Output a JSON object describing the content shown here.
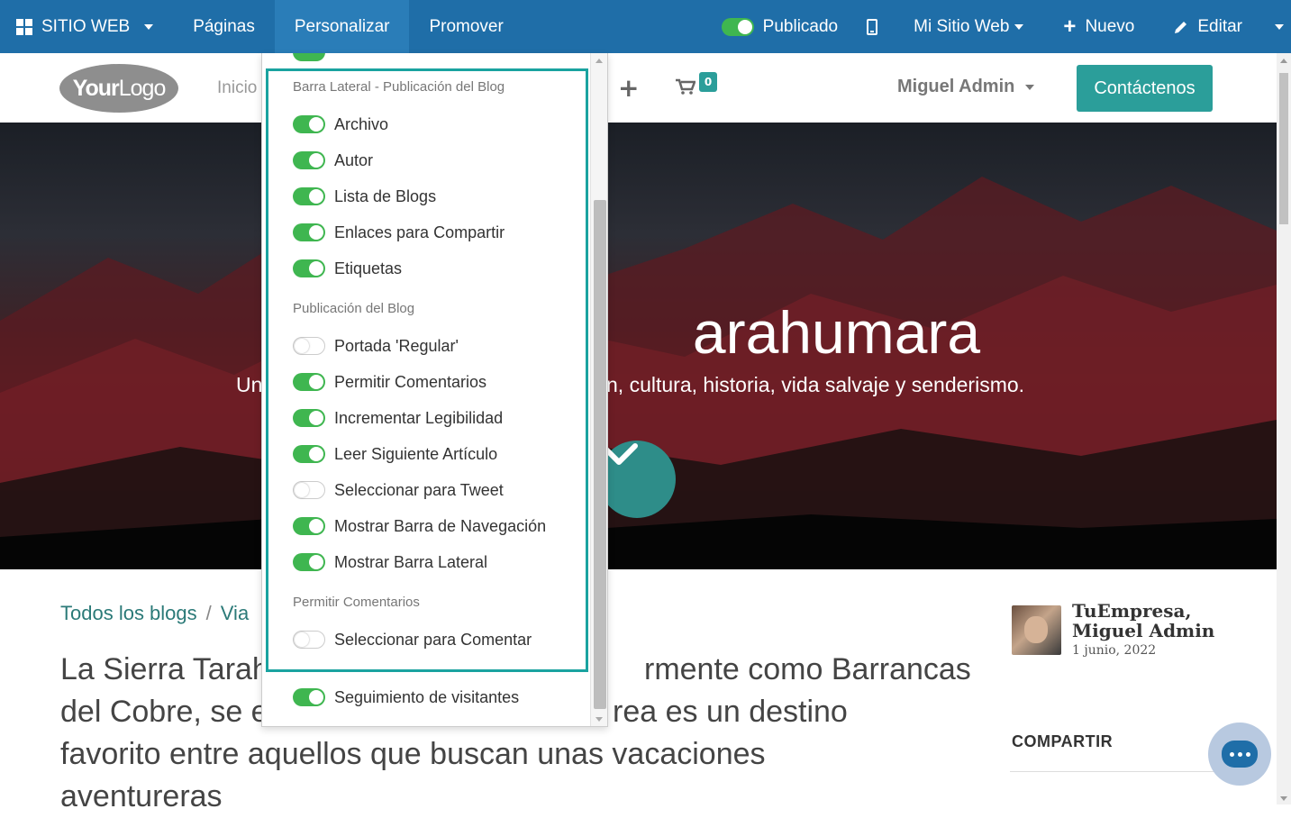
{
  "topbar": {
    "brand": "SITIO WEB",
    "menu": [
      {
        "label": "Páginas"
      },
      {
        "label": "Personalizar"
      },
      {
        "label": "Promover"
      }
    ],
    "published_label": "Publicado",
    "site_selector": "Mi Sitio Web",
    "new_label": "Nuevo",
    "edit_label": "Editar"
  },
  "header": {
    "logo_bold": "Your",
    "logo_light": "Logo",
    "nav_first": "Inicio",
    "cart_count": "0",
    "user_name": "Miguel Admin",
    "contact_label": "Contáctenos"
  },
  "hero": {
    "title_visible": "arahumara",
    "subtitle_left": "Un",
    "subtitle_right": "n, cultura, historia, vida salvaje y senderismo."
  },
  "content": {
    "breadcrumb_all": "Todos los blogs",
    "breadcrumb_sep": "/",
    "breadcrumb_current": "Via",
    "lead_lines": [
      "La Sierra Tarah",
      "rmente como Barrancas",
      "del Cobre, se e",
      "rea es un destino",
      "favorito entre aquellos que buscan unas vacaciones",
      "aventureras"
    ]
  },
  "sidebar": {
    "author_name": "TuEmpresa, Miguel Admin",
    "date": "1 junio, 2022",
    "share_title": "COMPARTIR"
  },
  "customize_panel": {
    "sections": [
      {
        "title": "Barra Lateral - Publicación del Blog",
        "options": [
          {
            "label": "Archivo",
            "enabled": true
          },
          {
            "label": "Autor",
            "enabled": true
          },
          {
            "label": "Lista de Blogs",
            "enabled": true
          },
          {
            "label": "Enlaces para Compartir",
            "enabled": true
          },
          {
            "label": "Etiquetas",
            "enabled": true
          }
        ]
      },
      {
        "title": "Publicación del Blog",
        "options": [
          {
            "label": "Portada 'Regular'",
            "enabled": false
          },
          {
            "label": "Permitir Comentarios",
            "enabled": true
          },
          {
            "label": "Incrementar Legibilidad",
            "enabled": true
          },
          {
            "label": "Leer Siguiente Artículo",
            "enabled": true
          },
          {
            "label": "Seleccionar para Tweet",
            "enabled": false
          },
          {
            "label": "Mostrar Barra de Navegación",
            "enabled": true
          },
          {
            "label": "Mostrar Barra Lateral",
            "enabled": true
          }
        ]
      },
      {
        "title": "Permitir Comentarios",
        "options": [
          {
            "label": "Seleccionar para Comentar",
            "enabled": false
          }
        ]
      }
    ],
    "extra_option": {
      "label": "Seguimiento de visitantes",
      "enabled": true
    }
  },
  "colors": {
    "admin_bar": "#1f6ea8",
    "toggle_on": "#3fb650",
    "highlight": "#1aa3a0",
    "accent": "#2b9e9a"
  }
}
